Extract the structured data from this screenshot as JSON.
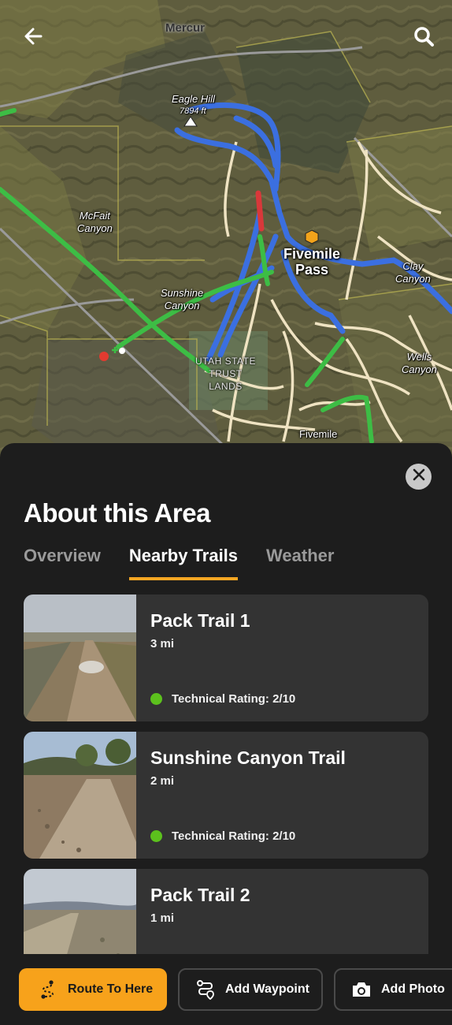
{
  "map": {
    "labels": {
      "mercur": "Mercur",
      "eagle_hill_name": "Eagle Hill",
      "eagle_hill_elev": "7894 ft",
      "mcfait": "McFait\nCanyon",
      "sunshine": "Sunshine\nCanyon",
      "fivemile_pass": "Fivemile\nPass",
      "clay": "Clay\nCanyon",
      "wells": "Wells\nCanyon",
      "utah_lands": "UTAH STATE\nTRUST\nLANDS",
      "fivemile": "Fivemile"
    },
    "icons": {
      "back": "arrow-left-icon",
      "search": "search-icon"
    },
    "colors": {
      "trail_blue": "#3b6fe0",
      "trail_green": "#3dbd45",
      "trail_red": "#d9383a",
      "road": "#efe3c2"
    }
  },
  "sheet": {
    "title": "About this Area",
    "close_icon": "close-icon",
    "tabs": [
      {
        "label": "Overview",
        "active": false
      },
      {
        "label": "Nearby Trails",
        "active": true
      },
      {
        "label": "Weather",
        "active": false
      }
    ],
    "trails": [
      {
        "name": "Pack Trail 1",
        "distance": "3 mi",
        "rating": "Technical Rating: 2/10"
      },
      {
        "name": "Sunshine Canyon Trail",
        "distance": "2 mi",
        "rating": "Technical Rating: 2/10"
      },
      {
        "name": "Pack Trail 2",
        "distance": "1 mi",
        "rating": ""
      }
    ],
    "accent": "#f6a623",
    "rating_color": "#5cc11d"
  },
  "actions": {
    "route": "Route To Here",
    "waypoint": "Add Waypoint",
    "photo": "Add Photo"
  }
}
